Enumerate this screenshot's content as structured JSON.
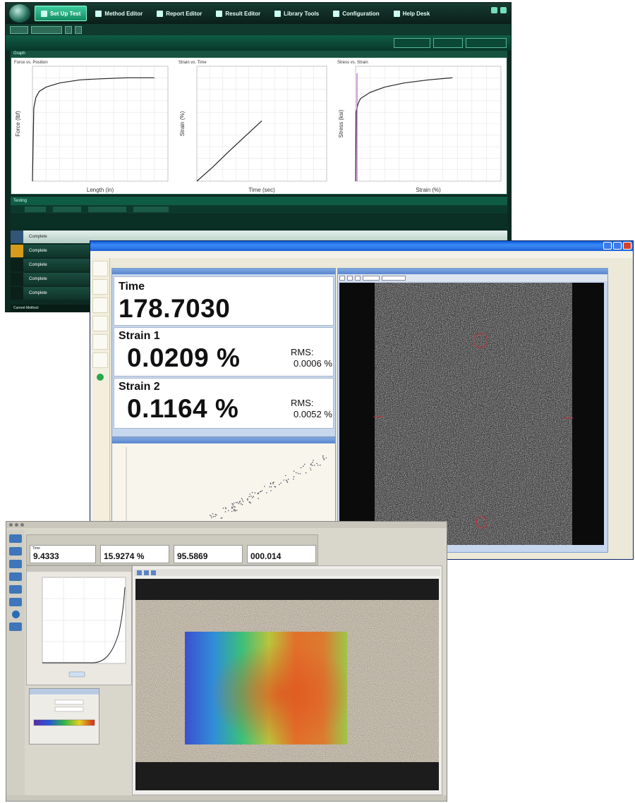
{
  "window_bluehill": {
    "nav_tabs": [
      {
        "label": "Set Up Test",
        "active": true
      },
      {
        "label": "Method Editor",
        "active": false
      },
      {
        "label": "Report Editor",
        "active": false
      },
      {
        "label": "Result Editor",
        "active": false
      },
      {
        "label": "Library Tools",
        "active": false
      },
      {
        "label": "Configuration",
        "active": false
      },
      {
        "label": "Help Desk",
        "active": false
      }
    ],
    "graph_section": "Graph",
    "charts": [
      {
        "type": "line",
        "title": "Force vs. Position",
        "xlabel": "Length (in)",
        "ylabel": "Force (lbf)",
        "x": [
          0,
          0.02,
          0.05,
          0.1,
          0.2,
          0.4,
          0.7,
          1.0,
          1.4,
          1.8
        ],
        "y": [
          0,
          0.7,
          0.8,
          0.86,
          0.9,
          0.94,
          0.97,
          0.98,
          0.99,
          0.99
        ],
        "xlim": [
          0,
          2
        ],
        "ylim": [
          0,
          1.1
        ]
      },
      {
        "type": "line",
        "title": "Strain vs. Time",
        "xlabel": "Time (sec)",
        "ylabel": "Strain (%)",
        "x": [
          0,
          0.5,
          1.0,
          1.5,
          2.0
        ],
        "y": [
          0,
          0.2,
          0.42,
          0.63,
          0.84
        ],
        "xlim": [
          0,
          4
        ],
        "ylim": [
          0,
          1.6
        ]
      },
      {
        "type": "line",
        "title": "Stress vs. Strain",
        "xlabel": "Strain (%)",
        "ylabel": "Stress (ksi)",
        "x": [
          0,
          0.01,
          0.05,
          0.1,
          0.3,
          0.6,
          1.0,
          1.5,
          2.0
        ],
        "y": [
          0,
          0.66,
          0.74,
          0.79,
          0.85,
          0.9,
          0.94,
          0.97,
          0.99
        ],
        "xlim": [
          0,
          3
        ],
        "ylim": [
          0,
          1.1
        ]
      }
    ],
    "testing_label": "Testing",
    "rows": [
      {
        "status": "Complete"
      },
      {
        "status": "Complete"
      },
      {
        "status": "Complete"
      },
      {
        "status": "Complete"
      },
      {
        "status": "Complete"
      }
    ],
    "status_text": "Current Method:"
  },
  "window_video": {
    "readouts": {
      "time_label": "Time",
      "time_value": "178.7030",
      "strain1_label": "Strain 1",
      "strain1_value": "0.0209 %",
      "strain1_rms_label": "RMS:",
      "strain1_rms_value": "0.0006 %",
      "strain2_label": "Strain 2",
      "strain2_value": "0.1164 %",
      "strain2_rms_label": "RMS:",
      "strain2_rms_value": "0.0052 %"
    }
  },
  "window_map": {
    "cards": [
      {
        "title": "Time",
        "value": "9.4333",
        "unit": ""
      },
      {
        "title": "",
        "value": "15.9274 %",
        "unit": ""
      },
      {
        "title": "",
        "value": "95.5869",
        "unit": ""
      },
      {
        "title": "",
        "value": "000.014",
        "unit": ""
      }
    ],
    "colors": {
      "map_low": "#3d4fd0",
      "map_mid": "#3bbf7a",
      "map_high": "#e2702a"
    }
  }
}
